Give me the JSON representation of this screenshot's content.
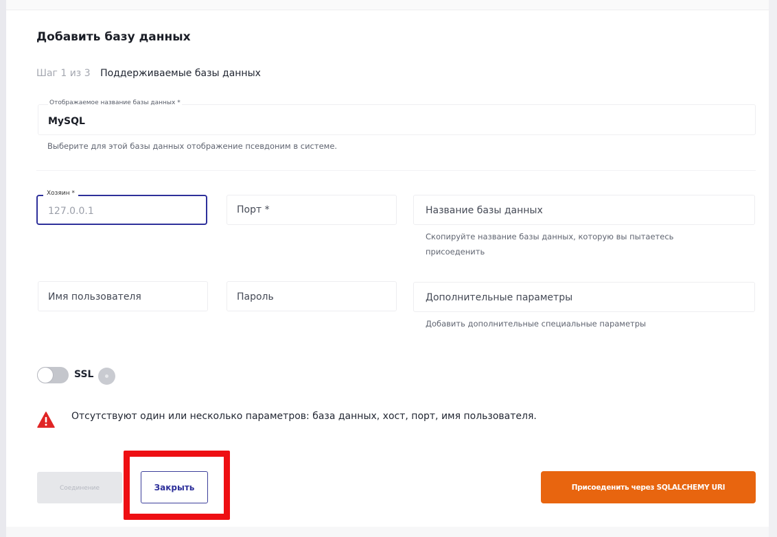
{
  "modal": {
    "title": "Добавить базу данных",
    "step_counter": "Шаг 1 из 3",
    "step_name": "Поддерживаемые базы данных"
  },
  "display_name": {
    "label": "Отображаемое название базы данных *",
    "value": "MySQL",
    "helper": "Выберите для этой базы данных отображение псевдоним в системе."
  },
  "host": {
    "label": "Хозяин *",
    "placeholder": "127.0.0.1"
  },
  "port": {
    "label": "Порт *"
  },
  "database_name": {
    "label": "Название базы данных",
    "helper": "Скопируйте название базы данных, которую вы пытаетесь присоеденить"
  },
  "username": {
    "label": "Имя пользователя"
  },
  "password": {
    "label": "Пароль"
  },
  "extra_params": {
    "label": "Дополнительные параметры",
    "helper": "Добавить дополнительные специальные параметры"
  },
  "ssl": {
    "label": "SSL",
    "enabled": false,
    "info_icon": "info-icon"
  },
  "error": {
    "icon": "warning-triangle-icon",
    "message": "Отсутствуют один или несколько параметров: база данных, хост, порт, имя пользователя."
  },
  "actions": {
    "connect_label": "Соединение",
    "close_label": "Закрыть",
    "sqlalchemy_label": "Присоеденить через SQLALCHEMY URI"
  },
  "colors": {
    "focus_border": "#2d2f9a",
    "primary_button": "#e8650f",
    "error_icon": "#e02424",
    "highlight_box": "#ee0f13"
  }
}
